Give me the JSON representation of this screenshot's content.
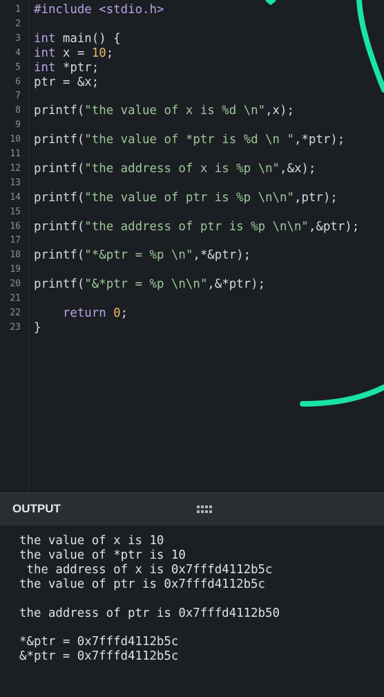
{
  "editor": {
    "lines": [
      {
        "n": "1",
        "tokens": [
          {
            "t": "#include <stdio.h>",
            "c": "kw"
          }
        ]
      },
      {
        "n": "2",
        "tokens": []
      },
      {
        "n": "3",
        "tokens": [
          {
            "t": "int",
            "c": "kw"
          },
          {
            "t": " main() {",
            "c": "plain"
          }
        ]
      },
      {
        "n": "4",
        "tokens": [
          {
            "t": "int",
            "c": "kw"
          },
          {
            "t": " x = ",
            "c": "plain"
          },
          {
            "t": "10",
            "c": "num"
          },
          {
            "t": ";",
            "c": "plain"
          }
        ]
      },
      {
        "n": "5",
        "tokens": [
          {
            "t": "int",
            "c": "kw"
          },
          {
            "t": " *ptr;",
            "c": "plain"
          }
        ]
      },
      {
        "n": "6",
        "tokens": [
          {
            "t": "ptr = &x;",
            "c": "plain"
          }
        ]
      },
      {
        "n": "7",
        "tokens": []
      },
      {
        "n": "8",
        "tokens": [
          {
            "t": "printf(",
            "c": "plain"
          },
          {
            "t": "\"the value of x is %d \\n\"",
            "c": "str"
          },
          {
            "t": ",x);",
            "c": "plain"
          }
        ]
      },
      {
        "n": "9",
        "tokens": []
      },
      {
        "n": "10",
        "tokens": [
          {
            "t": "printf(",
            "c": "plain"
          },
          {
            "t": "\"the value of *ptr is %d \\n \"",
            "c": "str"
          },
          {
            "t": ",*ptr);",
            "c": "plain"
          }
        ]
      },
      {
        "n": "11",
        "tokens": []
      },
      {
        "n": "12",
        "tokens": [
          {
            "t": "printf(",
            "c": "plain"
          },
          {
            "t": "\"the address of x is %p \\n\"",
            "c": "str"
          },
          {
            "t": ",&x);",
            "c": "plain"
          }
        ]
      },
      {
        "n": "13",
        "tokens": []
      },
      {
        "n": "14",
        "tokens": [
          {
            "t": "printf(",
            "c": "plain"
          },
          {
            "t": "\"the value of ptr is %p \\n\\n\"",
            "c": "str"
          },
          {
            "t": ",ptr);",
            "c": "plain"
          }
        ]
      },
      {
        "n": "15",
        "tokens": []
      },
      {
        "n": "16",
        "tokens": [
          {
            "t": "printf(",
            "c": "plain"
          },
          {
            "t": "\"the address of ptr is %p \\n\\n\"",
            "c": "str"
          },
          {
            "t": ",&ptr);",
            "c": "plain"
          }
        ]
      },
      {
        "n": "17",
        "tokens": []
      },
      {
        "n": "18",
        "tokens": [
          {
            "t": "printf(",
            "c": "plain"
          },
          {
            "t": "\"*&ptr = %p \\n\"",
            "c": "str"
          },
          {
            "t": ",*&ptr);",
            "c": "plain"
          }
        ]
      },
      {
        "n": "19",
        "tokens": []
      },
      {
        "n": "20",
        "tokens": [
          {
            "t": "printf(",
            "c": "plain"
          },
          {
            "t": "\"&*ptr = %p \\n\\n\"",
            "c": "str"
          },
          {
            "t": ",&*ptr);",
            "c": "plain"
          }
        ]
      },
      {
        "n": "21",
        "tokens": []
      },
      {
        "n": "22",
        "tokens": [
          {
            "t": "    return ",
            "c": "kw"
          },
          {
            "t": "0",
            "c": "num"
          },
          {
            "t": ";",
            "c": "plain"
          }
        ]
      },
      {
        "n": "23",
        "tokens": [
          {
            "t": "}",
            "c": "plain"
          }
        ]
      }
    ]
  },
  "output": {
    "title": "OUTPUT",
    "grip_icon": "drag-handle-icon",
    "lines": [
      "the value of x is 10",
      "the value of *ptr is 10",
      " the address of x is 0x7fffd4112b5c",
      "the value of ptr is 0x7fffd4112b5c",
      "",
      "the address of ptr is 0x7fffd4112b50",
      "",
      "*&ptr = 0x7fffd4112b5c",
      "&*ptr = 0x7fffd4112b5c"
    ]
  },
  "colors": {
    "background": "#1b1e22",
    "keyword": "#b8a4e8",
    "number": "#f0b76a",
    "string": "#9cc89a",
    "annotation_stroke": "#19e3a6"
  }
}
